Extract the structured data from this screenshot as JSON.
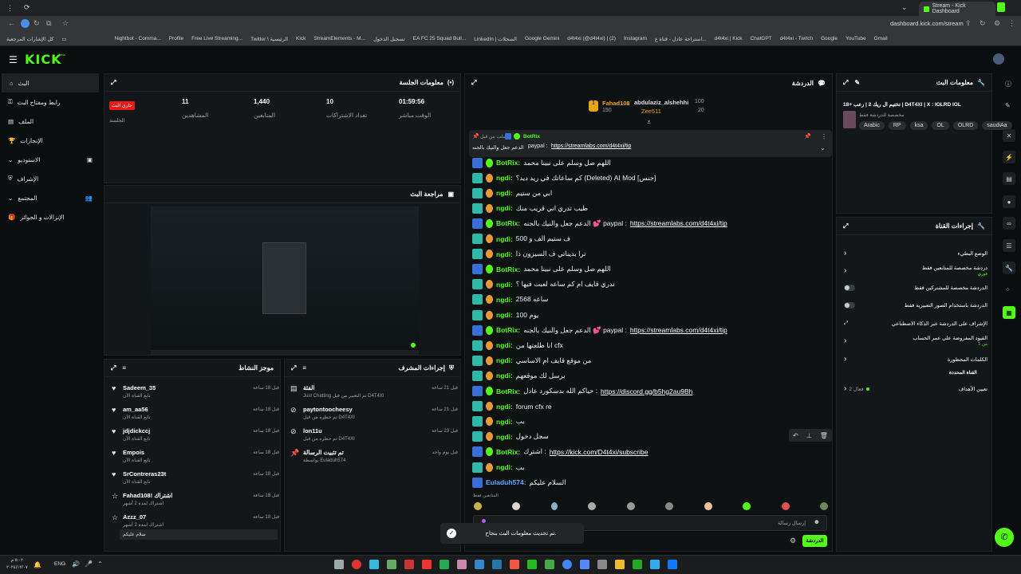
{
  "browser": {
    "tabs": [
      {
        "label": "Stream - Kick Dashboard"
      }
    ],
    "url": "dashboard.kick.com/stream",
    "bookmarks": [
      "كل الإشارات المرجعية",
      "Nightbot - Comma...",
      "Profile",
      "Free Live Streaming...",
      "Twitter \\ الرئيسية",
      "Kick",
      "StreamElements - M...",
      "تسجيل الدخول",
      "EA FC 25 Squad Buil...",
      "LinkedIn | السجلات",
      "Google Gemini",
      "d4t4xi (@d4t4xi) | (2)",
      "Instagram",
      "استراحة عادل - قناة ع...",
      "d4t4xi | Kick",
      "ChatGPT",
      "d4t4xi - Twitch",
      "Google",
      "YouTube",
      "Gmail"
    ]
  },
  "app": {
    "logo": "KICK",
    "logo_sub": "beta"
  },
  "nav": {
    "items": [
      {
        "label": "البث",
        "icon": "home-icon"
      },
      {
        "label": "رابط ومفتاح البث",
        "icon": "key-icon"
      },
      {
        "label": "الملف",
        "icon": "file-icon"
      },
      {
        "label": "الإنجازات",
        "icon": "trophy-icon"
      },
      {
        "label": "الاستوديو",
        "icon": "chevron-down-icon"
      },
      {
        "label": "الإشراف",
        "icon": "shield-icon"
      },
      {
        "label": "المجتمع",
        "icon": "chevron-down-icon"
      },
      {
        "label": "الإنزالات و الجوائز",
        "icon": "gift-icon"
      }
    ]
  },
  "session": {
    "title": "معلومات الجلسة",
    "live_badge": "جاري البث",
    "session_label": "الجلسة",
    "stats": [
      {
        "value": "11",
        "label": "المشاهدين"
      },
      {
        "value": "1,440",
        "label": "المتابعين"
      },
      {
        "value": "10",
        "label": "تعداد الاشتراكات"
      },
      {
        "value": "01:59:56",
        "label": "الوقت مباشر"
      }
    ]
  },
  "preview": {
    "title": "مراجعة البث"
  },
  "activity": {
    "title": "موجز النشاط",
    "items": [
      {
        "name": "Sadeem_35",
        "sub": "تابع القناة الآن",
        "time": "قبل 18 ساعة"
      },
      {
        "name": "am_aa56",
        "sub": "تابع القناة الآن",
        "time": "قبل 18 ساعة"
      },
      {
        "name": "jdjdickccj",
        "sub": "تابع القناة الآن",
        "time": "قبل 18 ساعة"
      },
      {
        "name": "Empois",
        "sub": "تابع القناة الآن",
        "time": "قبل 18 ساعة"
      },
      {
        "name": "SrContreras23t",
        "sub": "تابع القناة الآن",
        "time": "قبل 18 ساعة"
      },
      {
        "name": "Fahad108! اشتراك",
        "sub": "اشتراك لمدة 2 أشهر",
        "time": "قبل 18 ساعة"
      },
      {
        "name": "Azzz_07",
        "sub": "اشتراك لمدة 2 أشهر",
        "time": "قبل 18 ساعة"
      }
    ],
    "reply_text": "سلام عليكم"
  },
  "mod": {
    "title": "إجراءات المشرف",
    "items": [
      {
        "name": "الفئة",
        "sub": "Just Chatting تم التغيير من قبل D4T4XI",
        "time": "قبل 21 ساعة"
      },
      {
        "name": "paytontoocheesy",
        "sub": "تم حظره من قبل D4T4XI",
        "time": "قبل 21 ساعة"
      },
      {
        "name": "lon11u",
        "sub": "تم حظره من قبل D4T4XI",
        "time": "قبل 23 ساعة"
      },
      {
        "name": "تم تثبيت الرسالة",
        "sub": "بواسطة Euladuh574",
        "time": "قبل يوم واحد"
      }
    ]
  },
  "chat": {
    "title": "الدردشة",
    "leaderboard": [
      {
        "name": "Fahad108",
        "score": "150"
      },
      {
        "name": "abdulaziz_alshehhi",
        "score": "100"
      },
      {
        "name": "Zee511",
        "score": "20"
      }
    ],
    "pinned": {
      "by": "أرسلت من قبل",
      "user": "BotRix",
      "text": "الدعم جعل والنيك بالجنه",
      "link_prefix": "paypal :",
      "link": "https://streamlabs.com/d4t4xi/tip"
    },
    "messages": [
      {
        "user": "BotRix",
        "text": "اللهم صل وسلم على نبينا محمد",
        "link": ""
      },
      {
        "user": "ngdi",
        "text": "كم ساعاتك في ريد ديد؟ (Deleted) AI Mod [جنس]",
        "link": ""
      },
      {
        "user": "ngdi",
        "text": "ابي من ستيم",
        "link": ""
      },
      {
        "user": "ngdi",
        "text": "طيب تدري اني قريب منك",
        "link": ""
      },
      {
        "user": "BotRix",
        "text": "الدعم جعل والنيك بالجنه 💕 paypal :",
        "link": "https://streamlabs.com/d4t4xi/tip"
      },
      {
        "user": "ngdi",
        "text": "ف ستيم الف و 500",
        "link": ""
      },
      {
        "user": "ngdi",
        "text": "ترا بديناتي ف السيزون ذا",
        "link": ""
      },
      {
        "user": "BotRix",
        "text": "اللهم صل وسلم على نبينا محمد",
        "link": ""
      },
      {
        "user": "ngdi",
        "text": "تدري قايف ام كم ساعه لعبت فيها ؟",
        "link": ""
      },
      {
        "user": "ngdi",
        "text": "ساعه 2568",
        "link": ""
      },
      {
        "user": "ngdi",
        "text": "يوم 100",
        "link": ""
      },
      {
        "user": "BotRix",
        "text": "الدعم جعل والنيك بالجنه 💕 paypal :",
        "link": "https://streamlabs.com/d4t4xi/tip"
      },
      {
        "user": "ngdi",
        "text": "انا طلعتها من cfx",
        "link": ""
      },
      {
        "user": "ngdi",
        "text": "من موقع قايف ام الاساسي",
        "link": ""
      },
      {
        "user": "ngdi",
        "text": "برسل لك موقعهم",
        "link": ""
      },
      {
        "user": "BotRix",
        "text": "حياكم الله بدسكورد عادل :",
        "link": "https://discord.gg/b5hg2au9Bh"
      },
      {
        "user": "ngdi",
        "text": "forum cfx re",
        "link": ""
      },
      {
        "user": "ngdi",
        "text": "بب",
        "link": ""
      },
      {
        "user": "ngdi",
        "text": "سجل دخول",
        "link": ""
      },
      {
        "user": "BotRix",
        "text": "اشترك :",
        "link": "https://kick.com/D4t4xi/subscribe"
      },
      {
        "user": "ngdi",
        "text": "بب",
        "link": ""
      },
      {
        "user": "Euladuh574",
        "text": "السلام عليكم",
        "link": ""
      }
    ],
    "followers_only": "المتابعين فقط",
    "input_placeholder": "إرسال رسالة",
    "send_label": "الدردشة",
    "toast": "تم تحديث معلومات البث بنجاح."
  },
  "stream_info": {
    "title": "معلومات البث",
    "stream_title": "تختيم ال ريك 2 | رعب +18 | D4T4XI | X : IOLRD IOL",
    "category": "مخصصة للدردشة فقط",
    "tags": [
      "Arabic",
      "RP",
      "ksa",
      "OL",
      "OLRD",
      "saudiAa"
    ]
  },
  "channel_actions": {
    "title": "إجراءات القناة",
    "rows": [
      {
        "label": "الوضع البطيء",
        "control": "chevron"
      },
      {
        "label": "دردشة مخصصة للمتابعين فقط",
        "sub": "فوري",
        "control": "chevron"
      },
      {
        "label": "الدردشة مخصصة للمشتركين فقط",
        "control": "toggle"
      },
      {
        "label": "الدردشة باستخدام الصور التعبيرية فقط",
        "control": "toggle"
      },
      {
        "label": "الإشراف على الدردشة عبر الذكاء الاصطناعي",
        "control": "link"
      },
      {
        "label": "القيود المفروضة على عمر الحساب",
        "sub": "من 1",
        "control": "chevron"
      },
      {
        "label": "الكلمات المحظورة",
        "control": "chevron"
      }
    ],
    "section": "القناة المحددة",
    "goals_label": "تعيين الأهداف",
    "goals_value": "فعال 2"
  },
  "taskbar": {
    "lang": "ENG",
    "time": "٥:٠٢ م",
    "date": "٢٠٢٤/١٢/٠٧"
  },
  "colors": {
    "accent": "#53fc18",
    "live": "#e91916",
    "bg": "#0b0e0f",
    "panel": "#141719"
  }
}
